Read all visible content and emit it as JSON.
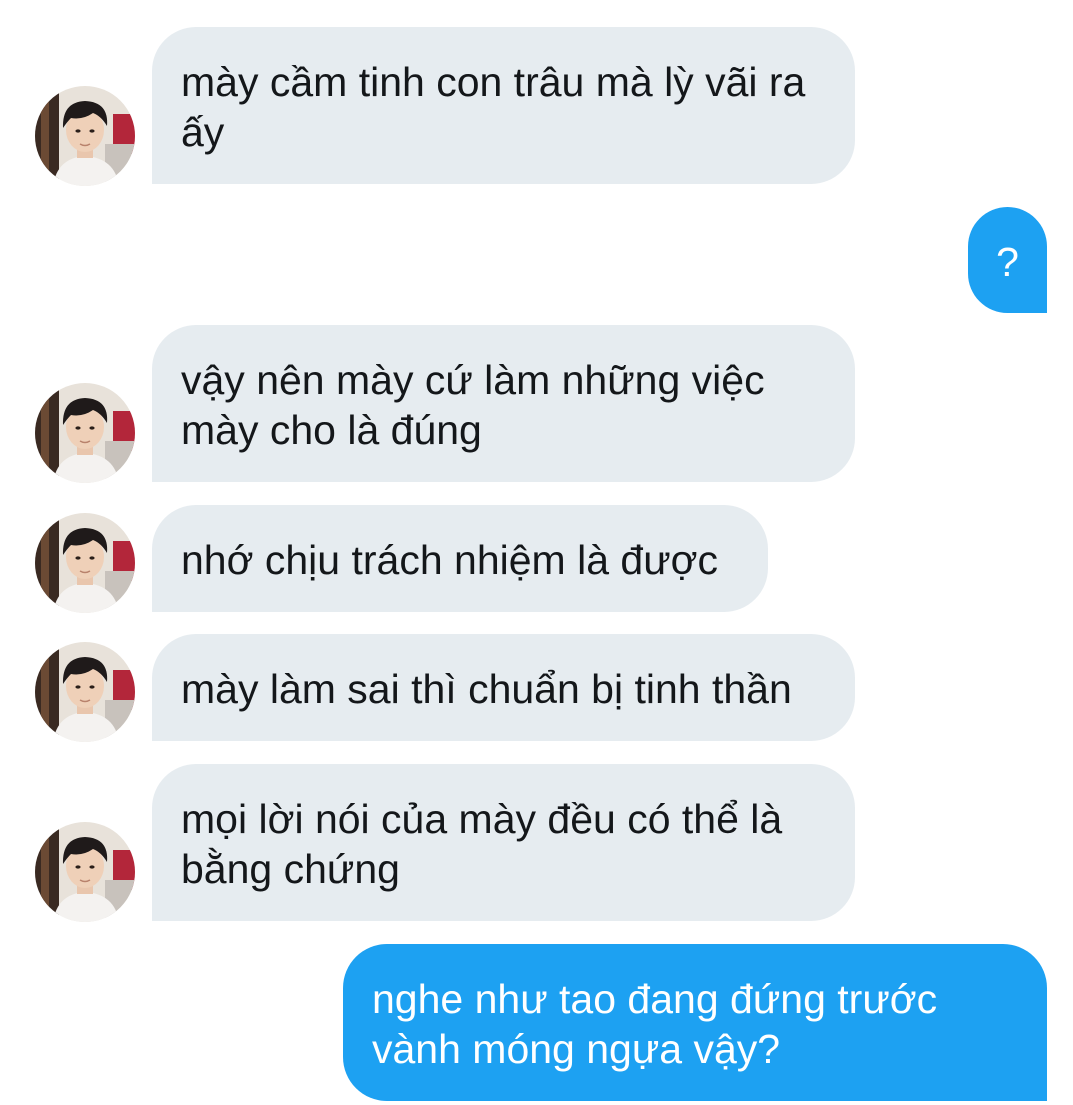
{
  "conversation": {
    "messages": [
      {
        "sender": "them",
        "text": "mày cầm tinh con trâu mà lỳ vãi ra ấy"
      },
      {
        "sender": "me",
        "text": "?"
      },
      {
        "sender": "them",
        "text": "vậy nên mày cứ làm những việc mày cho là đúng"
      },
      {
        "sender": "them",
        "text": "nhớ chịu trách nhiệm là được"
      },
      {
        "sender": "them",
        "text": "mày làm sai thì chuẩn bị tinh thần"
      },
      {
        "sender": "them",
        "text": "mọi lời nói của mày đều có thể là bằng chứng"
      },
      {
        "sender": "me",
        "text": "nghe như tao đang đứng trước vành móng ngựa vậy?"
      }
    ]
  },
  "colors": {
    "incoming_bubble": "#e6ecf0",
    "outgoing_bubble": "#1da1f2",
    "incoming_text": "#14171a",
    "outgoing_text": "#ffffff"
  },
  "icons": {
    "avatar": "contact-avatar-photo"
  }
}
